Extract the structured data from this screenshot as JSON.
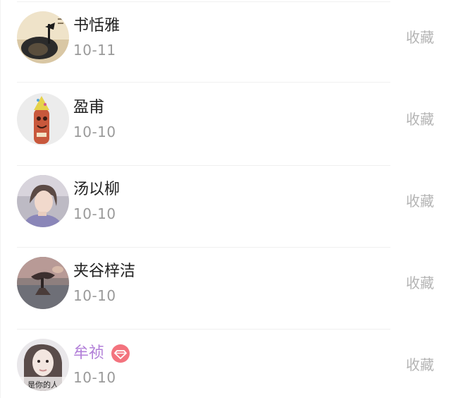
{
  "list": [
    {
      "name": "书恬雅",
      "date": "10-11",
      "action": "收藏",
      "vip": false
    },
    {
      "name": "盈甫",
      "date": "10-10",
      "action": "收藏",
      "vip": false
    },
    {
      "name": "汤以柳",
      "date": "10-10",
      "action": "收藏",
      "vip": false
    },
    {
      "name": "夹谷梓洁",
      "date": "10-10",
      "action": "收藏",
      "vip": false
    },
    {
      "name": "牟祯",
      "date": "10-10",
      "action": "收藏",
      "vip": true,
      "badge_icon": "diamond-icon",
      "avatar_caption": "是你的人"
    }
  ],
  "colors": {
    "name": "#222222",
    "vip_name": "#b27fd8",
    "date": "#9a9a9a",
    "action": "#b4b4b4",
    "vip_badge": "#f3737e"
  }
}
